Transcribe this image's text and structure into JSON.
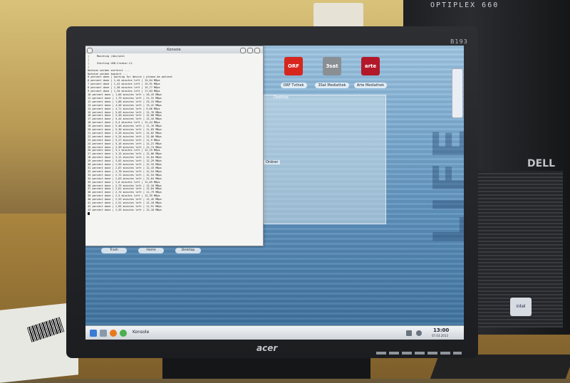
{
  "environment": {
    "tower_label": "OPTIPLEX 660",
    "tower_brand": "DELL",
    "sticker_text": "intel",
    "monitor_model": "B193",
    "monitor_brand": "acer"
  },
  "desktop": {
    "watermark": "LIFE",
    "icons": [
      {
        "label": "ORF Tvthek",
        "tile": "ORF",
        "color": "#d6261e"
      },
      {
        "label": "3Sat Mediathek",
        "tile": "3sat",
        "color": "#8a8f94"
      },
      {
        "label": "Arte Mediathek",
        "tile": "arte",
        "color": "#b3182a"
      }
    ],
    "panel": {
      "title": "Desktop",
      "folder": "Ordner"
    },
    "bottom_icons": [
      "Trash",
      "Home",
      "Desktop"
    ]
  },
  "konsole": {
    "title": "Konsole",
    "lines": [
      "|     Mounting /dev/sdc1",
      "|",
      "|     Starting USB-Creator-CL",
      "|",
      "Dateien werden entfernt ...",
      "Dateien werden kopiert ...",
      "0 percent done | waiting for device | please be patient",
      "6 percent done | 1,44 minutes left | 15,64 MBps",
      "7 percent done | 1,41 minutes left | 15,91 MBps",
      "8 percent done | 1,38 minutes left | 15,77 MBps",
      "9 percent done | 1,34 minutes left | 17,84 MBps",
      "10 percent done | 1,66 minutes left | 20,43 MBps",
      "11 percent done | 1,79 minutes left | 21,31 MBps",
      "12 percent done | 1,86 minutes left | 23,15 MBps",
      "13 percent done | 4,56 minutes left | 13,41 MBps",
      "14 percent done | 4,71 minutes left | 9,66 MBps",
      "15 percent done | 5,03 minutes left | 11,76 MBps",
      "16 percent done | 5,40 minutes left | 12,08 MBps",
      "17 percent done | 5,44 minutes left | 12,44 MBps",
      "18 percent done | 5,4 minutes left | 12,44 MBps",
      "19 percent done | 5,46 minutes left | 11,76 MBps",
      "20 percent done | 5,36 minutes left | 11,83 MBps",
      "21 percent done | 5,26 minutes left | 12,02 MBps",
      "22 percent done | 5,24 minutes left | 12,06 MBps",
      "23 percent done | 5,27 minutes left | 11,9 MBps",
      "24 percent done | 5,16 minutes left | 12,21 MBps",
      "25 percent done | 2,99 minutes left | 12,74 MBps",
      "26 percent done | 3,1 minutes left | 12,19 MBps",
      "27 percent done | 3,15 minutes left | 12,06 MBps",
      "28 percent done | 3,12 minutes left | 12,04 MBps",
      "29 percent done | 3,02 minutes left | 12,29 MBps",
      "30 percent done | 2,95 minutes left | 12,34 MBps",
      "31 percent done | 2,87 minutes left | 12,43 MBps",
      "32 percent done | 2,78 minutes left | 12,54 MBps",
      "33 percent done | 2,72 minutes left | 12,54 MBps",
      "34 percent done | 2,63 minutes left | 12,64 MBps",
      "35 percent done | 2,6 minutes left | 12,69 MBps",
      "36 percent done | 2,75 minutes left | 12,10 MBps",
      "37 percent done | 2,61 minutes left | 12,04 MBps",
      "38 percent done | 2,74 minutes left | 11,79 MBps",
      "39 percent done | 2,5 minutes left | 12,39 MBps",
      "40 percent done | 2,53 minutes left | 12,45 MBps",
      "41 percent done | 2,51 minutes left | 12,10 MBps",
      "42 percent done | 2,65 minutes left | 11,91 MBps",
      "43 percent done | 2,55 minutes left | 12,18 MBps"
    ]
  },
  "taskbar": {
    "task": "Konsole",
    "clock": "13:00",
    "date": "07.03.2013"
  }
}
